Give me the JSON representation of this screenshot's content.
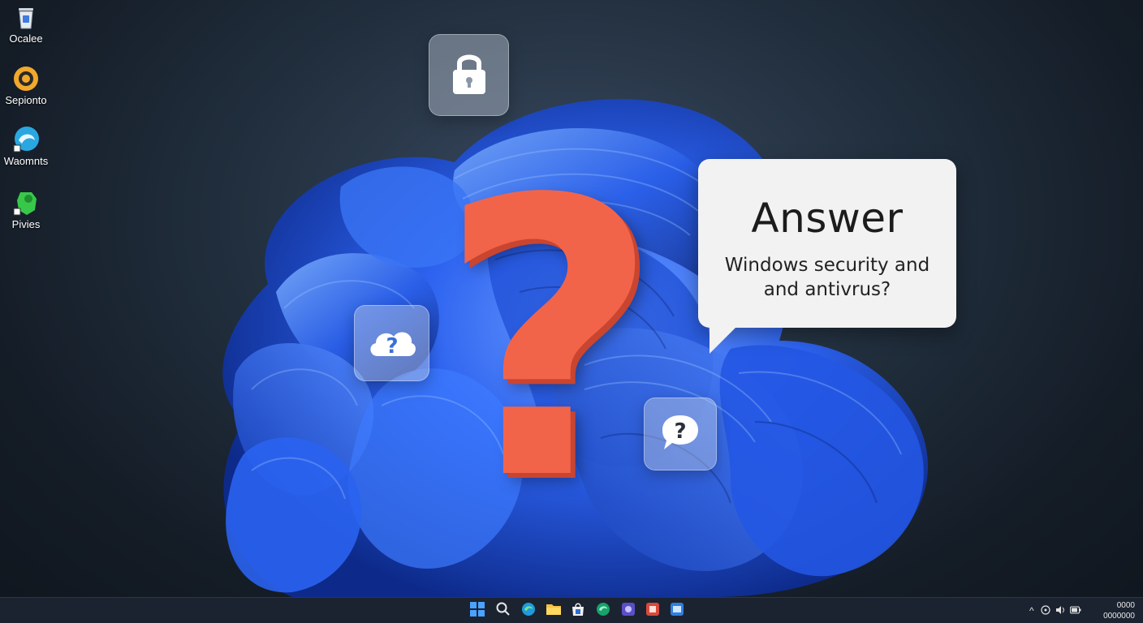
{
  "desktop": {
    "icons": [
      {
        "label": "Ocalee",
        "icon": "recycle-bin-icon"
      },
      {
        "label": "Sepionto",
        "icon": "orange-ring-icon"
      },
      {
        "label": "Waomnts",
        "icon": "blue-swirl-app-icon"
      },
      {
        "label": "Pivies",
        "icon": "green-puzzle-app-icon"
      }
    ]
  },
  "floating_icons": [
    {
      "icon": "lock-icon"
    },
    {
      "icon": "cloud-question-icon"
    },
    {
      "icon": "chat-question-icon"
    }
  ],
  "big_symbol": {
    "text": "?",
    "color": "#f2644a"
  },
  "answer_bubble": {
    "title": "Answer",
    "line1": "Windows security and",
    "line2": "and antivrus?"
  },
  "taskbar": {
    "apps": [
      {
        "icon": "windows-start-icon"
      },
      {
        "icon": "search-icon"
      },
      {
        "icon": "edge-browser-icon"
      },
      {
        "icon": "file-explorer-icon"
      },
      {
        "icon": "store-icon"
      },
      {
        "icon": "edge-alt-icon"
      },
      {
        "icon": "app-purple-icon"
      },
      {
        "icon": "app-red-icon"
      },
      {
        "icon": "app-blue-icon"
      }
    ],
    "tray": {
      "chevron": "^",
      "time": "0000",
      "date": "0000000"
    }
  },
  "colors": {
    "accent_blue": "#2f6bff",
    "question_orange": "#f2644a",
    "taskbar_bg": "#1b2330"
  }
}
